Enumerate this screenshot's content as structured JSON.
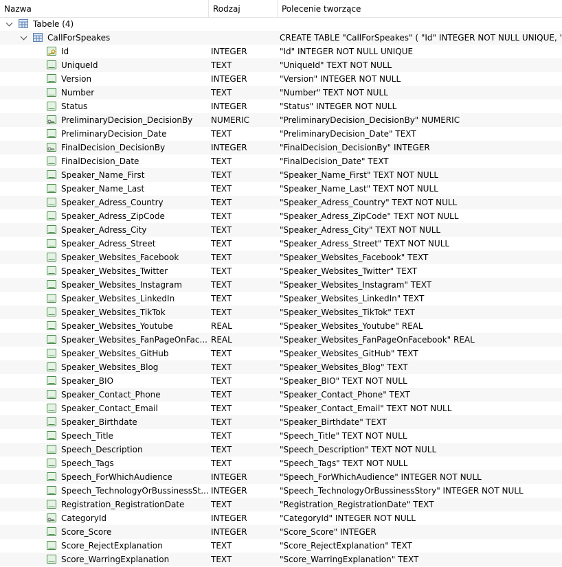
{
  "header": {
    "name": "Nazwa",
    "type": "Rodzaj",
    "command": "Polecenie tworzące"
  },
  "tables_node": {
    "label": "Tabele (4)"
  },
  "table": {
    "name": "CallForSpeakes",
    "command": "CREATE TABLE \"CallForSpeakes\" ( \"Id\" INTEGER NOT NULL UNIQUE, \"Ur"
  },
  "fields": [
    {
      "name": "Id",
      "type": "INTEGER",
      "cmd": "\"Id\" INTEGER NOT NULL UNIQUE",
      "icon": "key-field-icon"
    },
    {
      "name": "UniqueId",
      "type": "TEXT",
      "cmd": "\"UniqueId\" TEXT NOT NULL",
      "icon": "field-icon"
    },
    {
      "name": "Version",
      "type": "INTEGER",
      "cmd": "\"Version\" INTEGER NOT NULL",
      "icon": "field-icon"
    },
    {
      "name": "Number",
      "type": "TEXT",
      "cmd": "\"Number\" TEXT NOT NULL",
      "icon": "field-icon"
    },
    {
      "name": "Status",
      "type": "INTEGER",
      "cmd": "\"Status\" INTEGER NOT NULL",
      "icon": "field-icon"
    },
    {
      "name": "PreliminaryDecision_DecisionBy",
      "type": "NUMERIC",
      "cmd": "\"PreliminaryDecision_DecisionBy\" NUMERIC",
      "icon": "foreign-key-field-icon"
    },
    {
      "name": "PreliminaryDecision_Date",
      "type": "TEXT",
      "cmd": "\"PreliminaryDecision_Date\" TEXT",
      "icon": "field-icon"
    },
    {
      "name": "FinalDecision_DecisionBy",
      "type": "INTEGER",
      "cmd": "\"FinalDecision_DecisionBy\" INTEGER",
      "icon": "foreign-key-field-icon"
    },
    {
      "name": "FinalDecision_Date",
      "type": "TEXT",
      "cmd": "\"FinalDecision_Date\" TEXT",
      "icon": "field-icon"
    },
    {
      "name": "Speaker_Name_First",
      "type": "TEXT",
      "cmd": "\"Speaker_Name_First\" TEXT NOT NULL",
      "icon": "field-icon"
    },
    {
      "name": "Speaker_Name_Last",
      "type": "TEXT",
      "cmd": "\"Speaker_Name_Last\" TEXT NOT NULL",
      "icon": "field-icon"
    },
    {
      "name": "Speaker_Adress_Country",
      "type": "TEXT",
      "cmd": "\"Speaker_Adress_Country\" TEXT NOT NULL",
      "icon": "field-icon"
    },
    {
      "name": "Speaker_Adress_ZipCode",
      "type": "TEXT",
      "cmd": "\"Speaker_Adress_ZipCode\" TEXT NOT NULL",
      "icon": "field-icon"
    },
    {
      "name": "Speaker_Adress_City",
      "type": "TEXT",
      "cmd": "\"Speaker_Adress_City\" TEXT NOT NULL",
      "icon": "field-icon"
    },
    {
      "name": "Speaker_Adress_Street",
      "type": "TEXT",
      "cmd": "\"Speaker_Adress_Street\" TEXT NOT NULL",
      "icon": "field-icon"
    },
    {
      "name": "Speaker_Websites_Facebook",
      "type": "TEXT",
      "cmd": "\"Speaker_Websites_Facebook\" TEXT",
      "icon": "field-icon"
    },
    {
      "name": "Speaker_Websites_Twitter",
      "type": "TEXT",
      "cmd": "\"Speaker_Websites_Twitter\" TEXT",
      "icon": "field-icon"
    },
    {
      "name": "Speaker_Websites_Instagram",
      "type": "TEXT",
      "cmd": "\"Speaker_Websites_Instagram\" TEXT",
      "icon": "field-icon"
    },
    {
      "name": "Speaker_Websites_LinkedIn",
      "type": "TEXT",
      "cmd": "\"Speaker_Websites_LinkedIn\" TEXT",
      "icon": "field-icon"
    },
    {
      "name": "Speaker_Websites_TikTok",
      "type": "TEXT",
      "cmd": "\"Speaker_Websites_TikTok\" TEXT",
      "icon": "field-icon"
    },
    {
      "name": "Speaker_Websites_Youtube",
      "type": "REAL",
      "cmd": "\"Speaker_Websites_Youtube\" REAL",
      "icon": "field-icon"
    },
    {
      "name": "Speaker_Websites_FanPageOnFac...",
      "type": "REAL",
      "cmd": "\"Speaker_Websites_FanPageOnFacebook\" REAL",
      "icon": "field-icon"
    },
    {
      "name": "Speaker_Websites_GitHub",
      "type": "TEXT",
      "cmd": "\"Speaker_Websites_GitHub\" TEXT",
      "icon": "field-icon"
    },
    {
      "name": "Speaker_Websites_Blog",
      "type": "TEXT",
      "cmd": "\"Speaker_Websites_Blog\" TEXT",
      "icon": "field-icon"
    },
    {
      "name": "Speaker_BIO",
      "type": "TEXT",
      "cmd": "\"Speaker_BIO\" TEXT NOT NULL",
      "icon": "field-icon"
    },
    {
      "name": "Speaker_Contact_Phone",
      "type": "TEXT",
      "cmd": "\"Speaker_Contact_Phone\" TEXT",
      "icon": "field-icon"
    },
    {
      "name": "Speaker_Contact_Email",
      "type": "TEXT",
      "cmd": "\"Speaker_Contact_Email\" TEXT NOT NULL",
      "icon": "field-icon"
    },
    {
      "name": "Speaker_Birthdate",
      "type": "TEXT",
      "cmd": "\"Speaker_Birthdate\" TEXT",
      "icon": "field-icon"
    },
    {
      "name": "Speech_Title",
      "type": "TEXT",
      "cmd": "\"Speech_Title\" TEXT NOT NULL",
      "icon": "field-icon"
    },
    {
      "name": "Speech_Description",
      "type": "TEXT",
      "cmd": "\"Speech_Description\" TEXT NOT NULL",
      "icon": "field-icon"
    },
    {
      "name": "Speech_Tags",
      "type": "TEXT",
      "cmd": "\"Speech_Tags\" TEXT NOT NULL",
      "icon": "field-icon"
    },
    {
      "name": "Speech_ForWhichAudience",
      "type": "INTEGER",
      "cmd": "\"Speech_ForWhichAudience\" INTEGER NOT NULL",
      "icon": "field-icon"
    },
    {
      "name": "Speech_TechnologyOrBussinessSt...",
      "type": "INTEGER",
      "cmd": "\"Speech_TechnologyOrBussinessStory\" INTEGER NOT NULL",
      "icon": "field-icon"
    },
    {
      "name": "Registration_RegistrationDate",
      "type": "TEXT",
      "cmd": "\"Registration_RegistrationDate\" TEXT",
      "icon": "field-icon"
    },
    {
      "name": "CategoryId",
      "type": "INTEGER",
      "cmd": "\"CategoryId\" INTEGER NOT NULL",
      "icon": "foreign-key-field-icon"
    },
    {
      "name": "Score_Score",
      "type": "INTEGER",
      "cmd": "\"Score_Score\" INTEGER",
      "icon": "field-icon"
    },
    {
      "name": "Score_RejectExplanation",
      "type": "TEXT",
      "cmd": "\"Score_RejectExplanation\" TEXT",
      "icon": "field-icon"
    },
    {
      "name": "Score_WarringExplanation",
      "type": "TEXT",
      "cmd": "\"Score_WarringExplanation\" TEXT",
      "icon": "field-icon"
    }
  ],
  "colors": {
    "field_icon_border": "#4a8a4a",
    "field_icon_fill": "#e4f3e4",
    "table_icon_border": "#5a7fb0",
    "table_icon_fill": "#dbe7f6",
    "key_color": "#d9a21a",
    "alt_row": "#f7f7f7"
  }
}
